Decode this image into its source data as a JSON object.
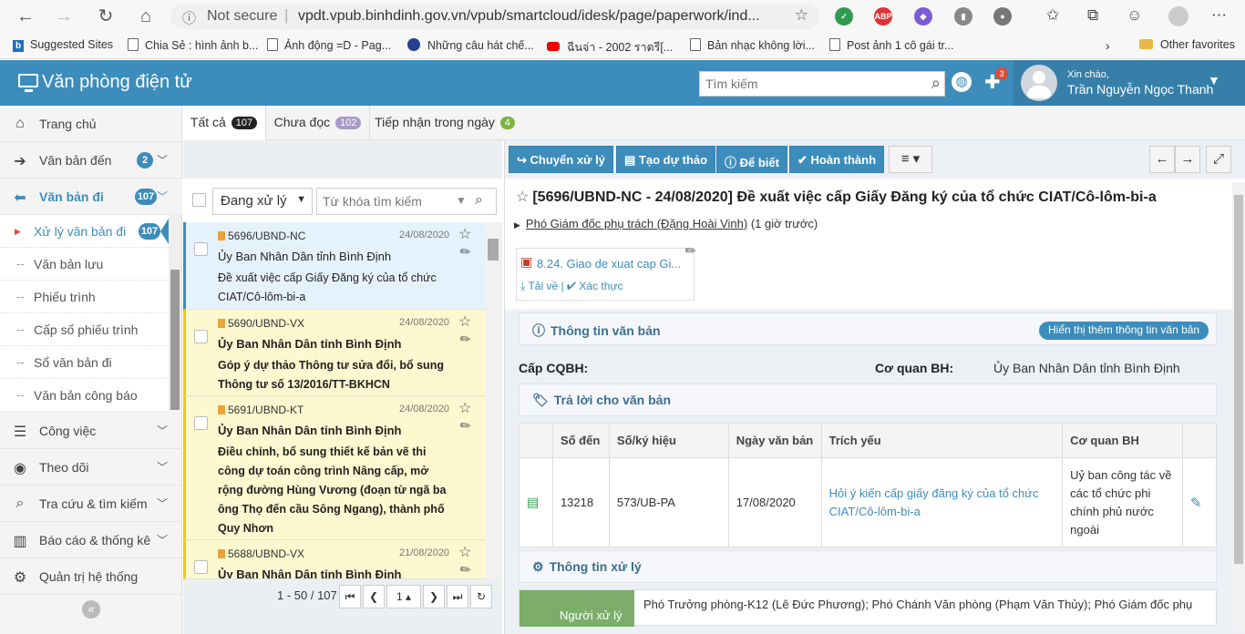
{
  "browser": {
    "address_security": "Not secure",
    "url": "vpdt.vpub.binhdinh.gov.vn/vpub/smartcloud/idesk/page/paperwork/ind...",
    "bookmarks": [
      "Suggested Sites",
      "Chia Sẻ : hình ảnh b...",
      "Ảnh động =D - Pag...",
      "Những câu hát chế...",
      "ฉีนจ่า - 2002 ราตรี[...",
      "Bản nhạc không lời...",
      "Post ảnh 1 cô gái tr..."
    ],
    "other_favorites": "Other favorites",
    "ext_abp": "ABP"
  },
  "app": {
    "title": "Văn phòng điện tử",
    "search_placeholder": "Tìm kiếm",
    "notif_count": "3",
    "greeting": "Xin chào,",
    "user_name": "Trần Nguyễn Ngọc Thanh"
  },
  "sidebar": {
    "home": "Trang chủ",
    "incoming": {
      "label": "Văn bản đến",
      "count": "2"
    },
    "outgoing": {
      "label": "Văn bản đi",
      "count": "107"
    },
    "sub": [
      {
        "label": "Xử lý văn bản đi",
        "count": "107"
      },
      {
        "label": "Văn bản lưu"
      },
      {
        "label": "Phiếu trình"
      },
      {
        "label": "Cấp số phiếu trình"
      },
      {
        "label": "Sổ văn bản đi"
      },
      {
        "label": "Văn bản công báo"
      }
    ],
    "work": "Công việc",
    "follow": "Theo dõi",
    "lookup": "Tra cứu & tìm kiếm",
    "report": "Báo cáo & thống kê",
    "admin": "Quản trị hệ thống"
  },
  "tabs": [
    {
      "label": "Tất cả",
      "count": "107"
    },
    {
      "label": "Chưa đọc",
      "count": "102"
    },
    {
      "label": "Tiếp nhận trong ngày",
      "count": "4"
    }
  ],
  "list": {
    "status_select": "Đang xử lý",
    "keyword_placeholder": "Từ khóa tìm kiếm",
    "items": [
      {
        "number": "5696/UBND-NC",
        "date": "24/08/2020",
        "org": "Ủy Ban Nhân Dân tỉnh Bình Định",
        "summary": "Đề xuất việc cấp Giấy Đăng ký của tổ chức CIAT/Cô-lôm-bi-a"
      },
      {
        "number": "5690/UBND-VX",
        "date": "24/08/2020",
        "org": "Ủy Ban Nhân Dân tỉnh Bình Định",
        "summary": "Góp ý dự thảo Thông tư sửa đổi, bổ sung Thông tư số 13/2016/TT-BKHCN"
      },
      {
        "number": "5691/UBND-KT",
        "date": "24/08/2020",
        "org": "Ủy Ban Nhân Dân tỉnh Bình Định",
        "summary": "Điều chỉnh, bổ sung thiết kế bản vẽ thi công dự toán công trình Nâng cấp, mở rộng đường Hùng Vương (đoạn từ ngã ba ông Thọ đến cầu Sông Ngang), thành phố Quy Nhơn"
      },
      {
        "number": "5688/UBND-VX",
        "date": "21/08/2020",
        "org": "Ủy Ban Nhân Dân tỉnh Bình Định",
        "summary": ""
      }
    ],
    "pager": {
      "range": "1 - 50 / 107",
      "page": "1"
    }
  },
  "detail": {
    "actions": {
      "forward": "Chuyển xử lý",
      "draft": "Tạo dự thảo",
      "fyi": "Để biết",
      "complete": "Hoàn thành"
    },
    "title": "[5696/UBND-NC - 24/08/2020] Đề xuất việc cấp Giấy Đăng ký của tổ chức CIAT/Cô-lôm-bi-a",
    "assignee": "Phó Giám đốc phụ trách (Đặng Hoài Vinh)",
    "assignee_time": "(1 giờ trước)",
    "attachment": {
      "name": "8.24. Giao de xuat cap Gi...",
      "download": "Tải về",
      "verify": "Xác thực"
    },
    "info_header": "Thông tin văn bản",
    "show_more": "Hiển thị thêm thông tin văn bản",
    "cap_label": "Cấp CQBH:",
    "org_label": "Cơ quan BH:",
    "org_value": "Ủy Ban Nhân Dân tỉnh Bình Định",
    "reply_header": "Trả lời cho văn bản",
    "reply_table": {
      "headers": [
        "",
        "Số đến",
        "Số/ký hiệu",
        "Ngày văn bản",
        "Trích yếu",
        "Cơ quan BH",
        ""
      ],
      "rows": [
        {
          "in_no": "13218",
          "symbol": "573/UB-PA",
          "date": "17/08/2020",
          "summary": "Hỏi ý kiến cấp giấy đăng ký của tổ chức CIAT/Cô-lôm-bi-a",
          "org": "Uỷ ban công tác về các tổ chức phi chính phủ nước ngoài"
        }
      ]
    },
    "process_header": "Thông tin xử lý",
    "processor_label": "Người xử lý",
    "processor_value": "Phó Trưởng phòng-K12 (Lê Đức Phương); Phó Chánh Văn phòng (Phạm Văn Thủy); Phó Giám đốc phụ"
  }
}
